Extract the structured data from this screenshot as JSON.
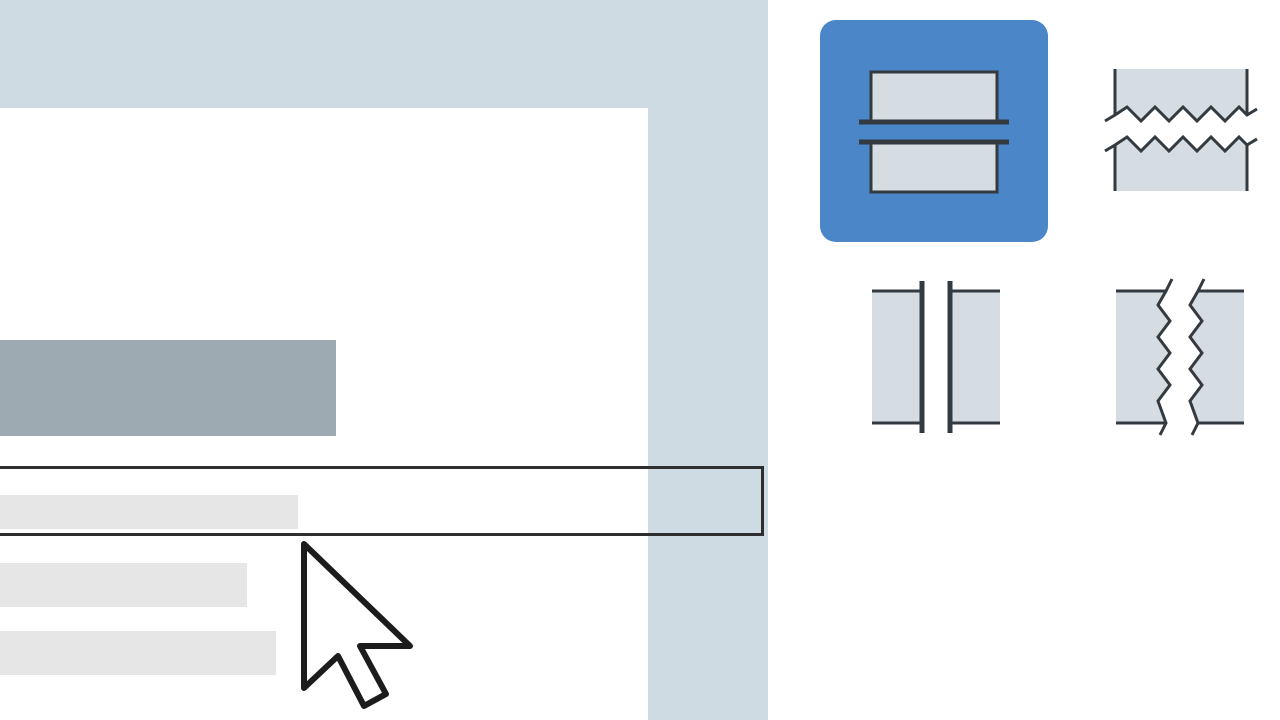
{
  "document_preview": {
    "page": "document-page",
    "heading_placeholder": "heading-block",
    "text_lines": [
      "text-line",
      "text-line",
      "text-line"
    ]
  },
  "break_options": [
    {
      "name": "page-break",
      "icon": "page-break-icon",
      "selected": true
    },
    {
      "name": "wrapped-page-break",
      "icon": "wrapped-page-break-icon",
      "selected": false
    },
    {
      "name": "column-break",
      "icon": "column-break-icon",
      "selected": false
    },
    {
      "name": "wrapped-column-break",
      "icon": "wrapped-column-break-icon",
      "selected": false
    }
  ],
  "colors": {
    "selected_accent": "#4a86c8",
    "pane_background": "#cfdbe2",
    "block_fill": "#d5dde3",
    "heading_fill": "#9eaab2",
    "stroke": "#333a40"
  },
  "pointer": "arrow-cursor-icon"
}
